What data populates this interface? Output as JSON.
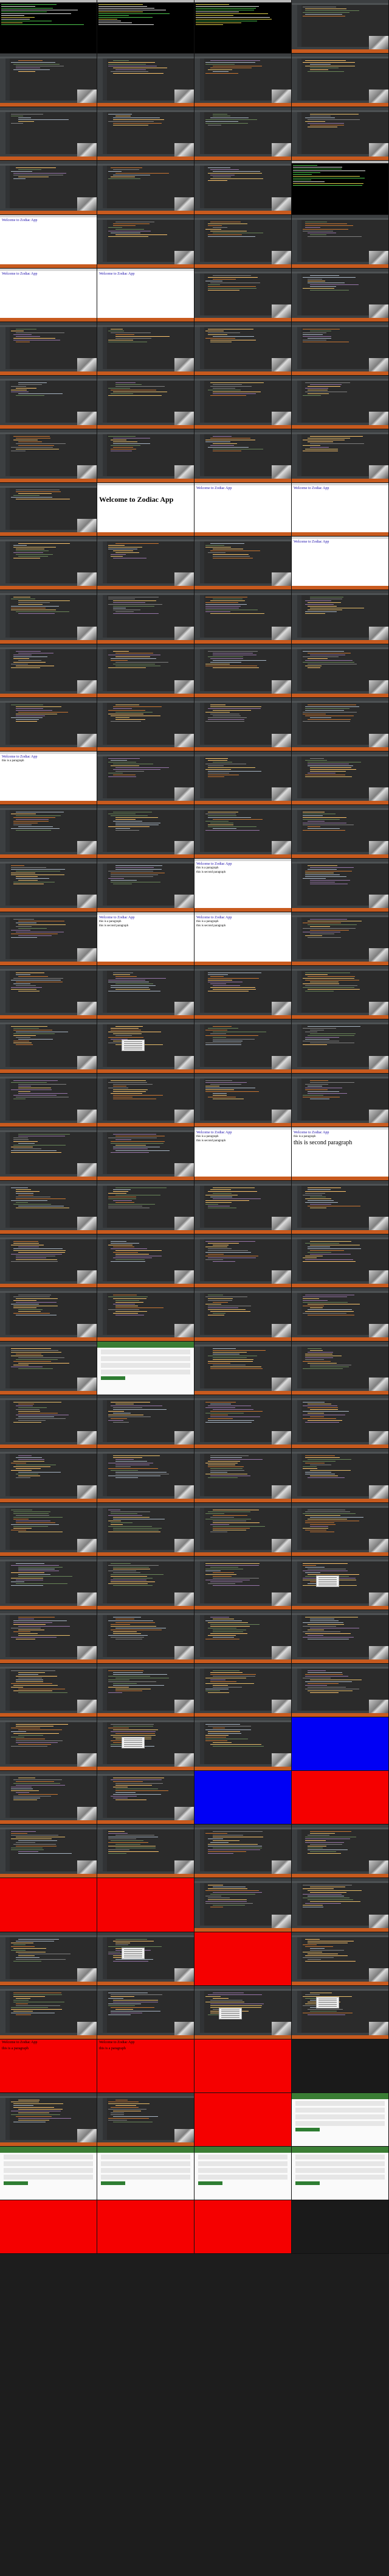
{
  "colors": {
    "code": [
      "#cc7832",
      "#a9b7c6",
      "#6a8759",
      "#9876aa",
      "#e8bf6a",
      "#ffc66d",
      "#808080"
    ],
    "terminal": [
      "#4ec94e",
      "#e6e6e6",
      "#e0d24a"
    ]
  },
  "text": {
    "hello": "Welcome to Zodiac App",
    "hello_small": "Welcome to Zodiac App",
    "para1": "this is a paragraph",
    "para2": "this is second paragraph"
  },
  "cells": [
    {
      "t": "term"
    },
    {
      "t": "term"
    },
    {
      "t": "term"
    },
    {
      "t": "editor",
      "n": 6
    },
    {
      "t": "editor",
      "n": 7
    },
    {
      "t": "editor",
      "n": 8
    },
    {
      "t": "editor",
      "n": 8
    },
    {
      "t": "editor",
      "n": 7
    },
    {
      "t": "editor",
      "n": 6
    },
    {
      "t": "editor",
      "n": 7
    },
    {
      "t": "editor",
      "n": 7
    },
    {
      "t": "editor",
      "n": 8
    },
    {
      "t": "editor",
      "n": 7
    },
    {
      "t": "editor",
      "n": 7
    },
    {
      "t": "editor",
      "n": 8
    },
    {
      "t": "term"
    },
    {
      "t": "browser",
      "k": "hello_small"
    },
    {
      "t": "editor",
      "n": 9
    },
    {
      "t": "editor",
      "n": 9
    },
    {
      "t": "editor",
      "n": 9
    },
    {
      "t": "browser",
      "k": "hello_small"
    },
    {
      "t": "browser",
      "k": "hello_small"
    },
    {
      "t": "editor",
      "n": 9
    },
    {
      "t": "editor",
      "n": 9
    },
    {
      "t": "editor",
      "n": 8
    },
    {
      "t": "editor",
      "n": 8
    },
    {
      "t": "editor",
      "n": 8
    },
    {
      "t": "editor",
      "n": 8
    },
    {
      "t": "editor",
      "n": 8
    },
    {
      "t": "editor",
      "n": 8
    },
    {
      "t": "editor",
      "n": 8
    },
    {
      "t": "editor",
      "n": 8
    },
    {
      "t": "editor",
      "n": 9
    },
    {
      "t": "editor",
      "n": 9
    },
    {
      "t": "editor",
      "n": 9
    },
    {
      "t": "editor",
      "n": 9
    },
    {
      "t": "editor",
      "n": 6
    },
    {
      "t": "browser",
      "k": "hello"
    },
    {
      "t": "browser",
      "k": "hello_small"
    },
    {
      "t": "browser",
      "k": "hello_small"
    },
    {
      "t": "editor",
      "n": 9
    },
    {
      "t": "editor",
      "n": 9
    },
    {
      "t": "editor",
      "n": 9
    },
    {
      "t": "browser",
      "k": "hello_small"
    },
    {
      "t": "editor",
      "n": 10
    },
    {
      "t": "editor",
      "n": 10
    },
    {
      "t": "editor",
      "n": 10
    },
    {
      "t": "editor",
      "n": 10
    },
    {
      "t": "editor",
      "n": 10
    },
    {
      "t": "editor",
      "n": 10
    },
    {
      "t": "editor",
      "n": 10
    },
    {
      "t": "editor",
      "n": 10
    },
    {
      "t": "editor",
      "n": 10
    },
    {
      "t": "editor",
      "n": 10
    },
    {
      "t": "editor",
      "n": 10
    },
    {
      "t": "editor",
      "n": 10
    },
    {
      "t": "browser",
      "k": "p1"
    },
    {
      "t": "editor",
      "n": 11
    },
    {
      "t": "editor",
      "n": 11
    },
    {
      "t": "editor",
      "n": 11
    },
    {
      "t": "editor",
      "n": 11
    },
    {
      "t": "editor",
      "n": 11
    },
    {
      "t": "editor",
      "n": 11
    },
    {
      "t": "editor",
      "n": 11
    },
    {
      "t": "editor",
      "n": 11
    },
    {
      "t": "editor",
      "n": 11
    },
    {
      "t": "browser",
      "k": "p2"
    },
    {
      "t": "editor",
      "n": 11
    },
    {
      "t": "editor",
      "n": 11
    },
    {
      "t": "browser",
      "k": "p2"
    },
    {
      "t": "browser",
      "k": "p2"
    },
    {
      "t": "editor",
      "n": 11
    },
    {
      "t": "editor",
      "n": 11
    },
    {
      "t": "editor",
      "n": 11
    },
    {
      "t": "editor",
      "n": 11
    },
    {
      "t": "editor",
      "n": 11
    },
    {
      "t": "editor",
      "n": 11
    },
    {
      "t": "editor",
      "n": 11,
      "pop": 1
    },
    {
      "t": "editor",
      "n": 11
    },
    {
      "t": "editor",
      "n": 11
    },
    {
      "t": "editor",
      "n": 11
    },
    {
      "t": "editor",
      "n": 11
    },
    {
      "t": "editor",
      "n": 11
    },
    {
      "t": "editor",
      "n": 11
    },
    {
      "t": "editor",
      "n": 11
    },
    {
      "t": "editor",
      "n": 11
    },
    {
      "t": "browser",
      "k": "p2"
    },
    {
      "t": "browser",
      "k": "p2big"
    },
    {
      "t": "editor",
      "n": 12
    },
    {
      "t": "editor",
      "n": 12
    },
    {
      "t": "editor",
      "n": 12
    },
    {
      "t": "editor",
      "n": 12
    },
    {
      "t": "editor",
      "n": 12
    },
    {
      "t": "editor",
      "n": 12
    },
    {
      "t": "editor",
      "n": 12
    },
    {
      "t": "editor",
      "n": 12
    },
    {
      "t": "editor",
      "n": 12
    },
    {
      "t": "editor",
      "n": 12
    },
    {
      "t": "editor",
      "n": 12
    },
    {
      "t": "editor",
      "n": 12
    },
    {
      "t": "editor",
      "n": 12
    },
    {
      "t": "site"
    },
    {
      "t": "editor",
      "n": 12
    },
    {
      "t": "editor",
      "n": 12
    },
    {
      "t": "editor",
      "n": 12
    },
    {
      "t": "editor",
      "n": 12
    },
    {
      "t": "editor",
      "n": 12
    },
    {
      "t": "editor",
      "n": 12
    },
    {
      "t": "editor",
      "n": 13
    },
    {
      "t": "editor",
      "n": 13
    },
    {
      "t": "editor",
      "n": 13
    },
    {
      "t": "editor",
      "n": 13
    },
    {
      "t": "editor",
      "n": 13
    },
    {
      "t": "editor",
      "n": 13
    },
    {
      "t": "editor",
      "n": 13
    },
    {
      "t": "editor",
      "n": 13
    },
    {
      "t": "editor",
      "n": 13
    },
    {
      "t": "editor",
      "n": 13
    },
    {
      "t": "editor",
      "n": 13
    },
    {
      "t": "editor",
      "n": 13,
      "pop": 1
    },
    {
      "t": "editor",
      "n": 13
    },
    {
      "t": "editor",
      "n": 13
    },
    {
      "t": "editor",
      "n": 13
    },
    {
      "t": "editor",
      "n": 13
    },
    {
      "t": "editor",
      "n": 13
    },
    {
      "t": "editor",
      "n": 13
    },
    {
      "t": "editor",
      "n": 13
    },
    {
      "t": "editor",
      "n": 13
    },
    {
      "t": "editor",
      "n": 13
    },
    {
      "t": "editor",
      "n": 13,
      "pop": 1
    },
    {
      "t": "editor",
      "n": 13
    },
    {
      "t": "blue"
    },
    {
      "t": "editor",
      "n": 13
    },
    {
      "t": "editor",
      "n": 13
    },
    {
      "t": "blue"
    },
    {
      "t": "red"
    },
    {
      "t": "editor",
      "n": 13
    },
    {
      "t": "editor",
      "n": 13
    },
    {
      "t": "editor",
      "n": 13
    },
    {
      "t": "editor",
      "n": 13
    },
    {
      "t": "red"
    },
    {
      "t": "red"
    },
    {
      "t": "editor",
      "n": 13
    },
    {
      "t": "editor",
      "n": 13
    },
    {
      "t": "editor",
      "n": 13
    },
    {
      "t": "editor",
      "n": 13,
      "pop": 1
    },
    {
      "t": "red"
    },
    {
      "t": "editor",
      "n": 13
    },
    {
      "t": "editor",
      "n": 13
    },
    {
      "t": "editor",
      "n": 13
    },
    {
      "t": "editor",
      "n": 13,
      "pop": 1
    },
    {
      "t": "editor",
      "n": 13,
      "pop": 1
    },
    {
      "t": "red",
      "k": "p2"
    },
    {
      "t": "red",
      "k": "p2"
    },
    {
      "t": "red"
    },
    {
      "t": "black"
    },
    {
      "t": "editor",
      "n": 13
    },
    {
      "t": "editor",
      "n": 13
    },
    {
      "t": "red"
    },
    {
      "t": "site"
    },
    {
      "t": "site"
    },
    {
      "t": "site"
    },
    {
      "t": "site"
    },
    {
      "t": "site"
    },
    {
      "t": "red"
    },
    {
      "t": "red"
    },
    {
      "t": "red"
    },
    {
      "t": "black"
    }
  ]
}
